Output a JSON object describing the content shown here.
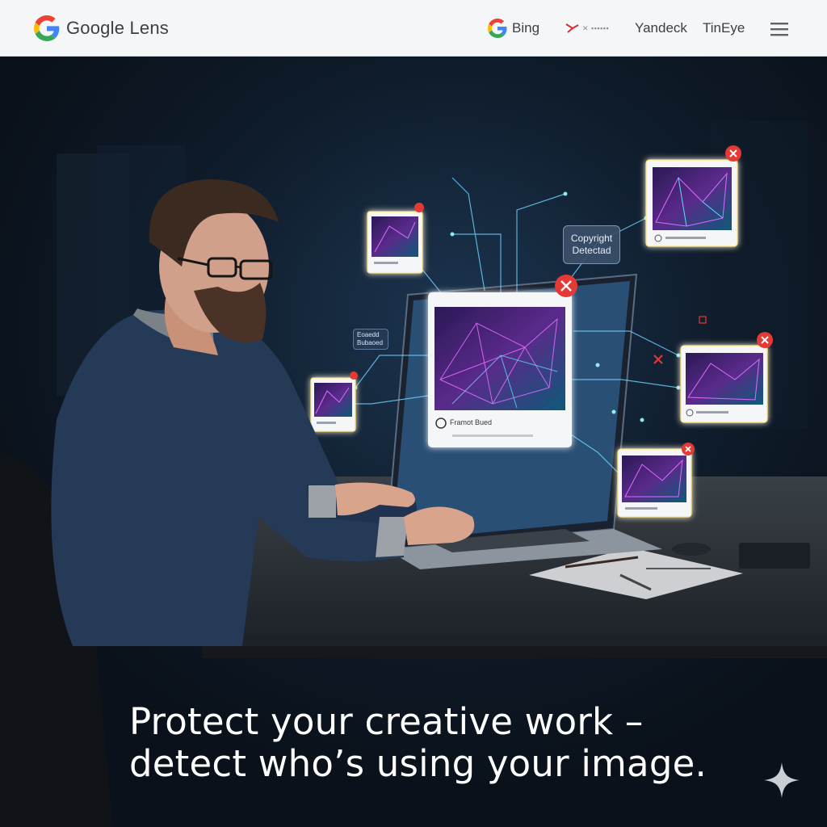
{
  "header": {
    "brand": "Google Lens",
    "nav": {
      "bing": "Bing",
      "mystery": "✕ ▪▪▪▪▪▪",
      "yandex": "Yandeck",
      "tineye": "TinEye"
    },
    "icons": {
      "brand_logo": "google-g-icon",
      "bing_logo": "google-g-icon",
      "menu": "hamburger-menu-icon"
    }
  },
  "hero": {
    "headline_line1": "Protect your creative work –",
    "headline_line2": "detect who’s using your image.",
    "badge": {
      "line1": "Copyright",
      "line2": "Detectad"
    },
    "float_labels": {
      "left_upper": "Eoaedd Bubaoed",
      "main_card": "Framot Bued"
    },
    "sparkle_icon": "sparkle-icon"
  },
  "colors": {
    "header_bg": "#f5f6f7",
    "hero_bg": "#0c141f",
    "alert_red": "#e53935",
    "glow_blue": "#4fc3f7",
    "google_blue": "#4285F4",
    "google_red": "#EA4335",
    "google_yellow": "#FBBC05",
    "google_green": "#34A853"
  }
}
